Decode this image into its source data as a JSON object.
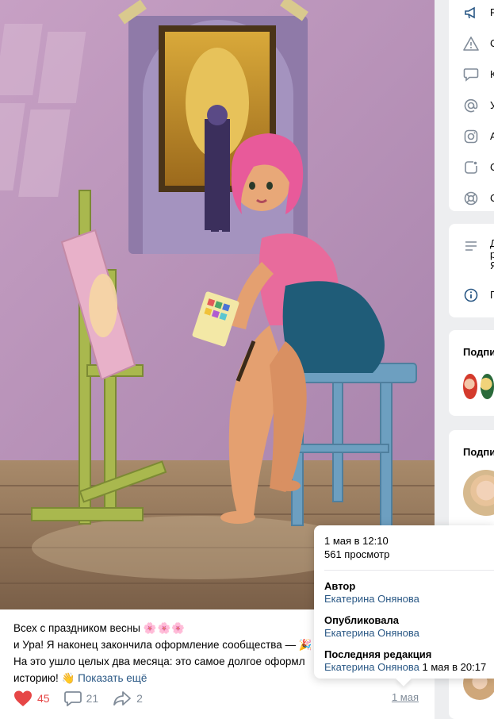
{
  "post": {
    "line1_text": "Всех с праздником весны ",
    "line1_emoji": "🌸🌸🌸",
    "line2": "и Ура! Я наконец закончила оформление сообщества — 🎉",
    "line3": "На это ушло целых два месяца: это самое долгое оформл",
    "line4_text": "историю! ",
    "line4_emoji": "👋",
    "show_more": "Показать ещё",
    "likes": "45",
    "comments": "21",
    "shares": "2",
    "date": "1 мая"
  },
  "sidebar": {
    "menu1": [
      {
        "icon": "megaphone-icon",
        "label": "Р"
      },
      {
        "icon": "warning-icon",
        "label": "С"
      },
      {
        "icon": "comment-icon",
        "label": "К"
      },
      {
        "icon": "at-icon",
        "label": "У"
      },
      {
        "icon": "instagram-icon",
        "label": "А"
      },
      {
        "icon": "clip-icon",
        "label": "С"
      },
      {
        "icon": "lifebuoy-icon",
        "label": "С"
      }
    ],
    "info_lines": [
      "Д",
      "р",
      "Я"
    ],
    "info_more": "П",
    "subs_title": "Подпи",
    "subs2_title": "Подпи"
  },
  "tooltip": {
    "datetime": "1 мая в 12:10",
    "views": "561 просмотр",
    "author_label": "Автор",
    "author": "Екатерина Онянова",
    "published_label": "Опубликовала",
    "published_by": "Екатерина Онянова",
    "edit_label": "Последняя редакция",
    "edited_by": "Екатерина Онянова",
    "edited_at": " 1 мая в 20:17"
  },
  "colors": {
    "link": "#2a5885",
    "like": "#e64646",
    "muted": "#818c99",
    "wall": "#b894b6"
  }
}
